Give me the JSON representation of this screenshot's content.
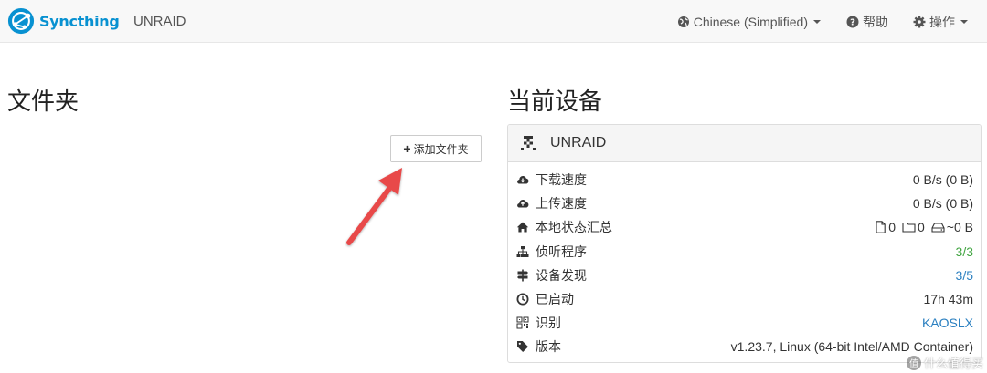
{
  "navbar": {
    "brand": "Syncthing",
    "device_name": "UNRAID",
    "language": "Chinese (Simplified)",
    "help": "帮助",
    "actions": "操作"
  },
  "folders": {
    "title": "文件夹",
    "add_button": "添加文件夹"
  },
  "this_device": {
    "title": "当前设备",
    "name": "UNRAID",
    "rows": [
      {
        "label": "下载速度",
        "value": "0 B/s (0 B)",
        "icon": "cloud-download-icon"
      },
      {
        "label": "上传速度",
        "value": "0 B/s (0 B)",
        "icon": "cloud-upload-icon"
      },
      {
        "label": "本地状态汇总",
        "icon": "home-icon"
      },
      {
        "label": "侦听程序",
        "value": "3/3",
        "icon": "sitemap-icon",
        "color": "#3fa43f"
      },
      {
        "label": "设备发现",
        "value": "3/5",
        "icon": "signpost-icon",
        "color": "#2a7fc0"
      },
      {
        "label": "已启动",
        "value": "17h 43m",
        "icon": "clock-icon"
      },
      {
        "label": "识别",
        "value": "KAOSLX",
        "icon": "qrcode-icon",
        "color": "#2a7fc0"
      },
      {
        "label": "版本",
        "value": "v1.23.7, Linux (64-bit Intel/AMD Container)",
        "icon": "tag-icon"
      }
    ],
    "local_state": {
      "files": "0",
      "dirs": "0",
      "size": "~0 B"
    }
  },
  "watermark": "什么值得买",
  "colors": {
    "brand": "#0891d1",
    "arrow": "#e84a4a",
    "green": "#3fa43f",
    "link": "#2a7fc0"
  }
}
